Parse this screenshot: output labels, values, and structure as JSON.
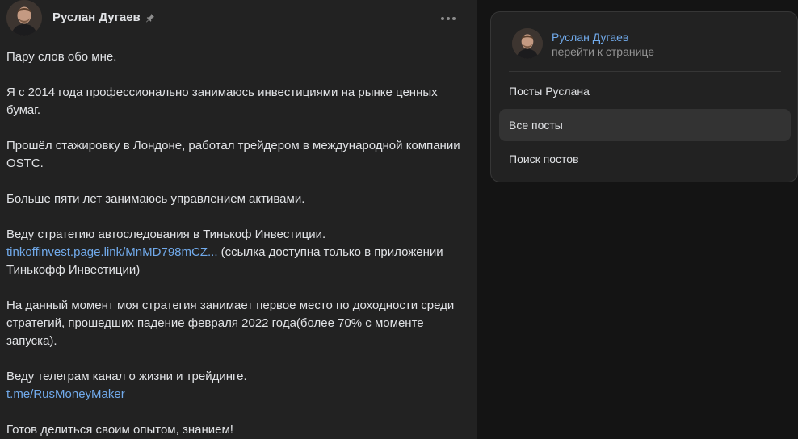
{
  "post": {
    "author": "Руслан Дугаев",
    "pinned_icon": "pin-icon",
    "more_icon": "more-horizontal-icon",
    "paragraphs": {
      "p1": "Пару слов обо мне.",
      "p2": "Я с 2014 года профессионально занимаюсь инвестициями на рынке ценных бумаг.",
      "p3": "Прошёл стажировку в Лондоне, работал трейдером в международной компании OSTC.",
      "p4": "Больше пяти лет занимаюсь управлением активами.",
      "p5_text": "Веду стратегию автоследования в Тинькоф Инвестиции.",
      "p5_link": "tinkoffinvest.page.link/MnMD798mCZ...",
      "p5_note": " (ссылка доступна только в приложении Тинькофф Инвестиции)",
      "p6": "На данный момент моя стратегия занимает первое место по доходности среди стратегий, прошедших падение февраля 2022 года(более 70% с моменте запуска).",
      "p7_text": "Веду телеграм канал о жизни и трейдинге.",
      "p7_link": "t.me/RusMoneyMaker",
      "p8": "Готов делиться своим опытом, знанием!"
    }
  },
  "sidebar": {
    "profile_name": "Руслан Дугаев",
    "profile_sub": "перейти к странице",
    "items": [
      {
        "label": "Посты Руслана",
        "active": false
      },
      {
        "label": "Все посты",
        "active": true
      },
      {
        "label": "Поиск постов",
        "active": false
      }
    ]
  },
  "colors": {
    "background": "#141414",
    "panel": "#222222",
    "text": "#e1e3e6",
    "link": "#71aaeb",
    "muted": "#939393",
    "active_item": "#333333"
  }
}
